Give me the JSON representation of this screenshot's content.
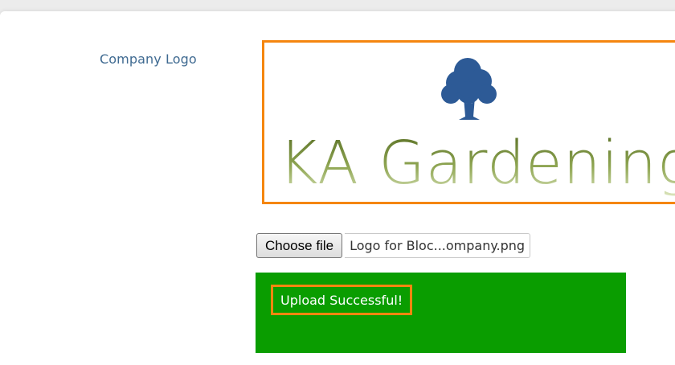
{
  "form": {
    "company_logo_label": "Company Logo"
  },
  "logo": {
    "brand_text": "KA Gardening",
    "tree_color": "#2d5a96",
    "text_color_top": "#556b22",
    "text_color_bottom": "#d7e2b4",
    "frame_color": "#f5860f"
  },
  "file_input": {
    "button_label": "Choose file",
    "selected_file": "Logo for Bloc...ompany.png"
  },
  "status": {
    "message": "Upload Successful!",
    "background_color": "#0a9d00"
  }
}
